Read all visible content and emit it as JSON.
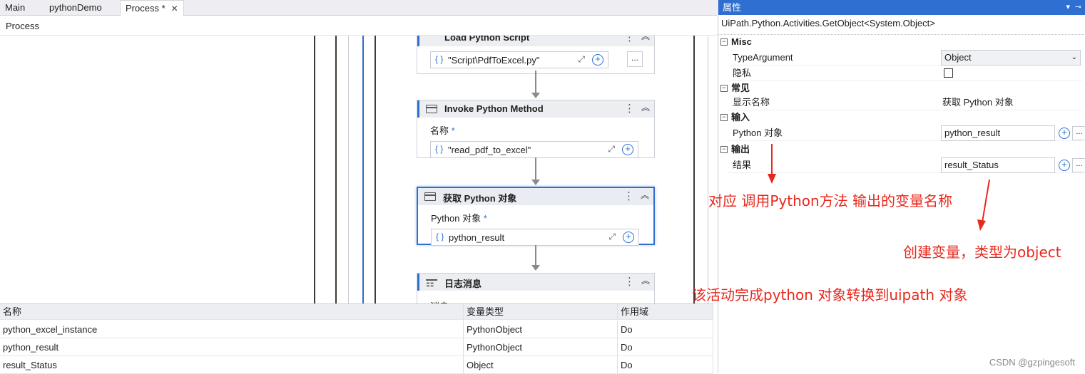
{
  "tabs": [
    {
      "label": "Main"
    },
    {
      "label": "pythonDemo"
    },
    {
      "label": "Process *"
    }
  ],
  "tab_close": "✕",
  "breadcrumb": "Process",
  "activities": {
    "load": {
      "title": "Load Python Script",
      "value": "\"Script\\PdfToExcel.py\""
    },
    "invoke": {
      "title": "Invoke Python Method",
      "field_label": "名称",
      "value": "\"read_pdf_to_excel\""
    },
    "getobj": {
      "title": "获取 Python 对象",
      "field_label": "Python 对象",
      "value": "python_result"
    },
    "log": {
      "title": "日志消息",
      "field_label": "消息"
    }
  },
  "required_mark": "*",
  "variables": {
    "headers": [
      "名称",
      "变量类型",
      "作用域"
    ],
    "rows": [
      [
        "python_excel_instance",
        "PythonObject",
        "Do"
      ],
      [
        "python_result",
        "PythonObject",
        "Do"
      ],
      [
        "result_Status",
        "Object",
        "Do"
      ]
    ]
  },
  "properties": {
    "panel_title": "属性",
    "activity_type": "UiPath.Python.Activities.GetObject<System.Object>",
    "categories": {
      "misc": "Misc",
      "common": "常见",
      "input": "输入",
      "output": "输出"
    },
    "type_argument_label": "TypeArgument",
    "type_argument_value": "Object",
    "private_label": "隐私",
    "display_name_label": "显示名称",
    "display_name_value": "获取 Python 对象",
    "python_object_label": "Python 对象",
    "python_object_value": "python_result",
    "result_label": "结果",
    "result_value": "result_Status"
  },
  "annotations": {
    "a1": "对应 调用Python方法 输出的变量名称",
    "a2": "创建变量，类型为object",
    "a3": "该活动完成python 对象转换到uipath 对象"
  },
  "watermark": "CSDN @gzpingesoft",
  "colors": {
    "accent": "#2e6fd1",
    "annotation": "#e8281d"
  }
}
